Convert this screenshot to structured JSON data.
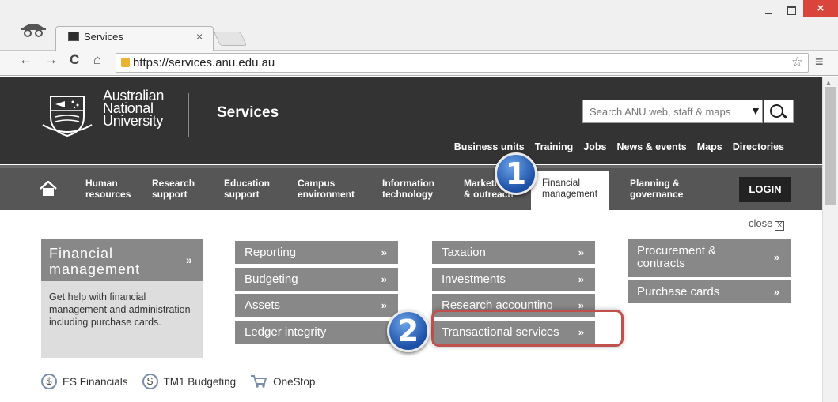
{
  "browser": {
    "tab_title": "Services",
    "tab_close": "×",
    "url": "https://services.anu.edu.au",
    "back_icon": "←",
    "forward_icon": "→",
    "reload_icon": "C",
    "home_icon": "⌂",
    "star_icon": "☆",
    "menu_icon": "≡",
    "close_symbol": "×"
  },
  "header": {
    "uni_line1": "Australian",
    "uni_line2": "National",
    "uni_line3": "University",
    "site_title": "Services",
    "search_placeholder": "Search ANU web, staff & maps",
    "search_dropdown": "▼",
    "links": [
      "Business units",
      "Training",
      "Jobs",
      "News & events",
      "Maps",
      "Directories"
    ]
  },
  "mainnav": {
    "items": [
      "Human\nresources",
      "Research\nsupport",
      "Education\nsupport",
      "Campus\nenvironment",
      "Information\ntechnology",
      "Marketing\n& outreach",
      "Financial\nmanagement",
      "Planning &\ngovernance"
    ],
    "login": "LOGIN"
  },
  "panel": {
    "close_label": "close",
    "close_box": "X",
    "section_title": "Financial\nmanagement",
    "section_arrow": "»",
    "section_desc": "Get help with financial management and administration including purchase cards.",
    "col1": [
      "Reporting",
      "Budgeting",
      "Assets",
      "Ledger integrity"
    ],
    "col2": [
      "Taxation",
      "Investments",
      "Research accounting",
      "Transactional services"
    ],
    "col3": [
      "Procurement &\ncontracts",
      "Purchase cards"
    ],
    "arrow": "»"
  },
  "shortcuts": {
    "items": [
      {
        "icon": "dollar-icon",
        "symbol": "$",
        "label": "ES Financials"
      },
      {
        "icon": "dollar-icon",
        "symbol": "$",
        "label": "TM1 Budgeting"
      },
      {
        "icon": "cart-icon",
        "symbol": "",
        "label": "OneStop"
      }
    ]
  },
  "callouts": {
    "one": "1",
    "two": "2"
  },
  "colors": {
    "header_bg": "#333333",
    "nav_bg": "#565656",
    "button_bg": "#888888",
    "callout_blue": "#1c4fa6",
    "highlight_red": "#c0504d"
  }
}
